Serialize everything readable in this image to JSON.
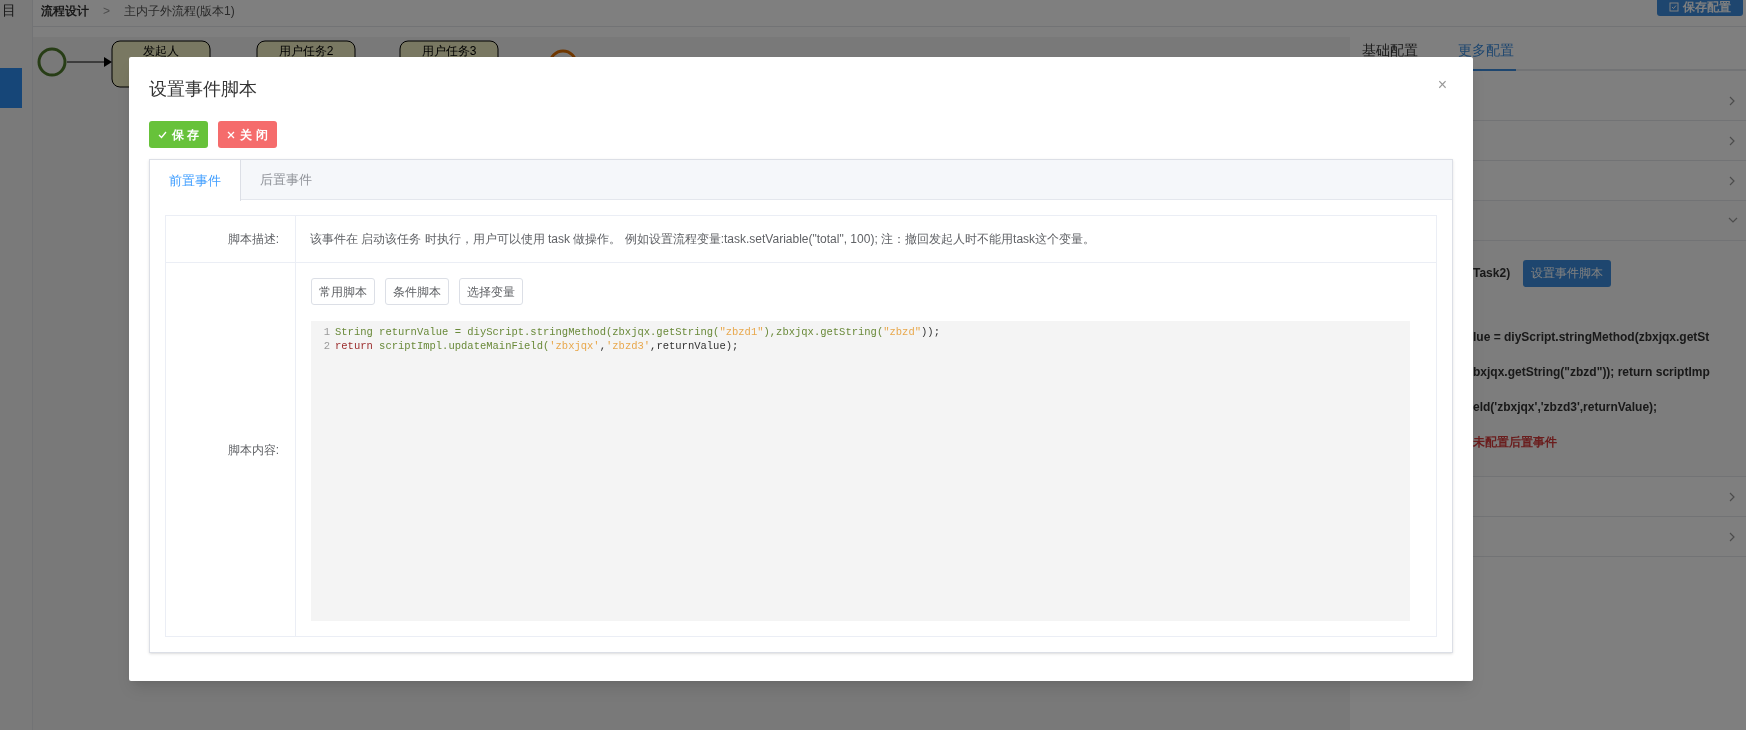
{
  "sidebar": {
    "label": "目",
    "items": [
      {
        "selected": true
      }
    ]
  },
  "breadcrumb": {
    "items": [
      "流程设计",
      "主内子外流程(版本1)"
    ],
    "separator": ">"
  },
  "save_config_button": "保存配置",
  "diagram": {
    "nodes": [
      {
        "kind": "start"
      },
      {
        "kind": "task",
        "label": "发起人"
      },
      {
        "kind": "task",
        "label": "用户任务2"
      },
      {
        "kind": "task",
        "label": "用户任务3"
      },
      {
        "kind": "end"
      }
    ]
  },
  "right_panel": {
    "tabs": [
      {
        "label": "基础配置",
        "selected": false
      },
      {
        "label": "更多配置",
        "selected": true
      }
    ],
    "sections": [
      {
        "expanded": false
      },
      {
        "expanded": false
      },
      {
        "expanded": false
      },
      {
        "expanded": true,
        "task_label": "Task2)",
        "button": "设置事件脚本",
        "script_lines": [
          "lue = diyScript.stringMethod(zbxjqx.getSt",
          "bxjqx.getString(\"zbzd\")); return scriptImp",
          "eld('zbxjqx','zbzd3',returnValue);"
        ],
        "notice": "未配置后置事件"
      },
      {
        "expanded": false
      },
      {
        "expanded": false
      }
    ]
  },
  "modal": {
    "title": "设置事件脚本",
    "close": "×",
    "buttons": [
      {
        "kind": "save",
        "label": "保 存"
      },
      {
        "kind": "close",
        "label": "关 闭"
      }
    ],
    "tabs": [
      {
        "label": "前置事件",
        "selected": true
      },
      {
        "label": "后置事件",
        "selected": false
      }
    ],
    "description": {
      "label": "脚本描述:",
      "text": "该事件在 启动该任务 时执行，用户可以使用 task 做操作。 例如设置流程变量:task.setVariable(\"total\", 100); 注：撤回发起人时不能用task这个变量。"
    },
    "content": {
      "label": "脚本内容:",
      "script_buttons": [
        "常用脚本",
        "条件脚本",
        "选择变量"
      ],
      "code_lines": [
        {
          "number": "1",
          "tokens": [
            {
              "kind": "plain",
              "text": "String returnValue = diyScript.stringMethod(zbxjqx.getString("
            },
            {
              "kind": "string",
              "text": "\"zbzd1\""
            },
            {
              "kind": "plain",
              "text": "),zbxjqx.getString("
            },
            {
              "kind": "string",
              "text": "\"zbzd\""
            },
            {
              "kind": "punct",
              "text": "));"
            }
          ]
        },
        {
          "number": "2",
          "tokens": [
            {
              "kind": "keyword",
              "text": "return"
            },
            {
              "kind": "plain",
              "text": " scriptImpl.updateMainField("
            },
            {
              "kind": "string",
              "text": "'zbxjqx'"
            },
            {
              "kind": "punct",
              "text": ","
            },
            {
              "kind": "string",
              "text": "'zbzd3'"
            },
            {
              "kind": "punct",
              "text": ",returnValue);"
            }
          ]
        }
      ]
    }
  }
}
